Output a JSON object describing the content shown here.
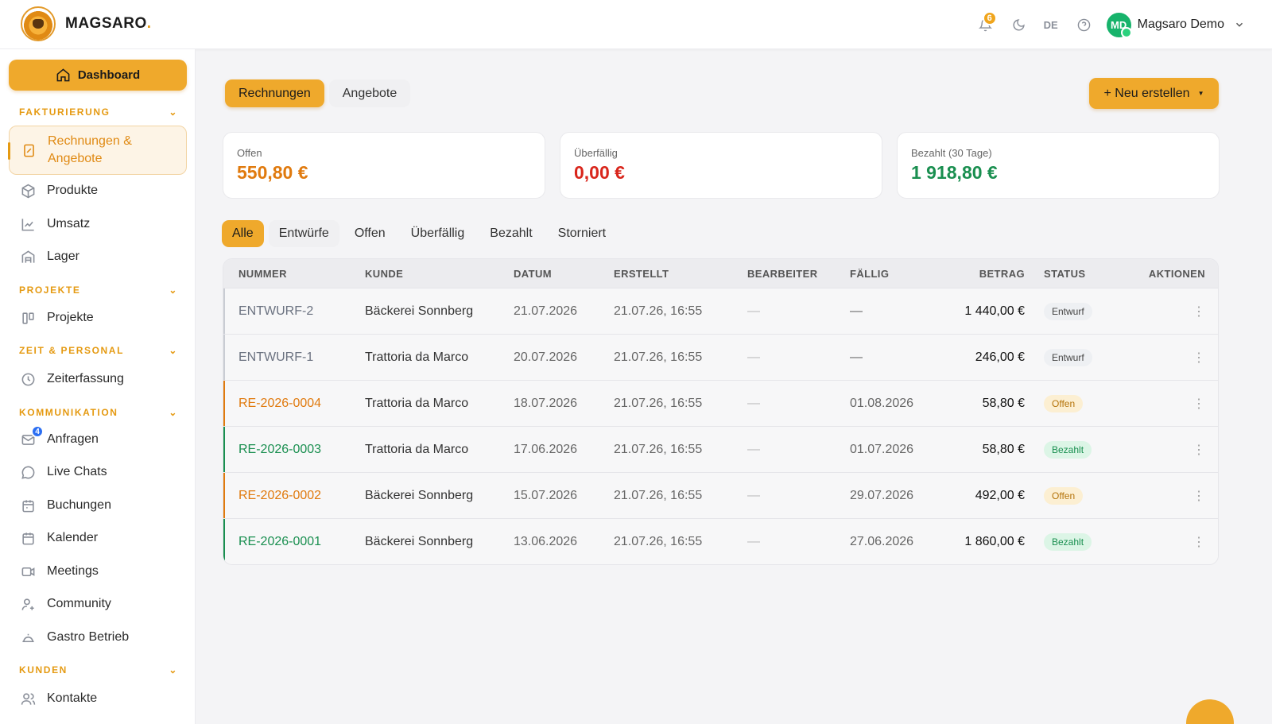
{
  "brand": {
    "name": "MAGSARO",
    "dot": "."
  },
  "header": {
    "notifications_count": "6",
    "language": "DE",
    "user_initials": "MD",
    "user_name": "Magsaro Demo"
  },
  "sidebar": {
    "dashboard": "Dashboard",
    "sections": [
      {
        "title": "FAKTURIERUNG"
      },
      {
        "title": "PROJEKTE"
      },
      {
        "title": "ZEIT & PERSONAL"
      },
      {
        "title": "KOMMUNIKATION"
      },
      {
        "title": "KUNDEN"
      }
    ],
    "items": {
      "rechnungen_line1": "Rechnungen &",
      "rechnungen_line2": "Angebote",
      "produkte": "Produkte",
      "umsatz": "Umsatz",
      "lager": "Lager",
      "projekte": "Projekte",
      "zeiterfassung": "Zeiterfassung",
      "anfragen": "Anfragen",
      "anfragen_badge": "4",
      "live_chats": "Live Chats",
      "buchungen": "Buchungen",
      "kalender": "Kalender",
      "meetings": "Meetings",
      "community": "Community",
      "gastro": "Gastro Betrieb",
      "kontakte": "Kontakte"
    }
  },
  "main": {
    "tabs": [
      "Rechnungen",
      "Angebote"
    ],
    "new_button": "+ Neu erstellen",
    "cards": [
      {
        "label": "Offen",
        "value": "550,80 €",
        "color": "#e07a0e"
      },
      {
        "label": "Überfällig",
        "value": "0,00 €",
        "color": "#d9261c"
      },
      {
        "label": "Bezahlt (30 Tage)",
        "value": "1 918,80 €",
        "color": "#1a8f50"
      }
    ],
    "filters": [
      "Alle",
      "Entwürfe",
      "Offen",
      "Überfällig",
      "Bezahlt",
      "Storniert"
    ],
    "columns": [
      "NUMMER",
      "KUNDE",
      "DATUM",
      "ERSTELLT",
      "BEARBEITER",
      "FÄLLIG",
      "BETRAG",
      "STATUS",
      "AKTIONEN"
    ],
    "rows": [
      {
        "nummer": "ENTWURF-2",
        "kunde": "Bäckerei Sonnberg",
        "datum": "21.07.2026",
        "erstellt": "21.07.26, 16:55",
        "bearbeiter": "—",
        "faellig": "—",
        "betrag": "1 440,00 €",
        "status": "Entwurf",
        "action": "⋮"
      },
      {
        "nummer": "ENTWURF-1",
        "kunde": "Trattoria da Marco",
        "datum": "20.07.2026",
        "erstellt": "21.07.26, 16:55",
        "bearbeiter": "—",
        "faellig": "—",
        "betrag": "246,00 €",
        "status": "Entwurf",
        "action": "⋮"
      },
      {
        "nummer": "RE-2026-0004",
        "kunde": "Trattoria da Marco",
        "datum": "18.07.2026",
        "erstellt": "21.07.26, 16:55",
        "bearbeiter": "—",
        "faellig": "01.08.2026",
        "betrag": "58,80 €",
        "status": "Offen",
        "action": "⋮"
      },
      {
        "nummer": "RE-2026-0003",
        "kunde": "Trattoria da Marco",
        "datum": "17.06.2026",
        "erstellt": "21.07.26, 16:55",
        "bearbeiter": "—",
        "faellig": "01.07.2026",
        "betrag": "58,80 €",
        "status": "Bezahlt",
        "action": "⋮"
      },
      {
        "nummer": "RE-2026-0002",
        "kunde": "Bäckerei Sonnberg",
        "datum": "15.07.2026",
        "erstellt": "21.07.26, 16:55",
        "bearbeiter": "—",
        "faellig": "29.07.2026",
        "betrag": "492,00 €",
        "status": "Offen",
        "action": "⋮"
      },
      {
        "nummer": "RE-2026-0001",
        "kunde": "Bäckerei Sonnberg",
        "datum": "13.06.2026",
        "erstellt": "21.07.26, 16:55",
        "bearbeiter": "—",
        "faellig": "27.06.2026",
        "betrag": "1 860,00 €",
        "status": "Bezahlt",
        "action": "⋮"
      }
    ]
  },
  "colors": {
    "accent": "#efa92c",
    "entwurf": "#6b7280",
    "offen": "#e07a0e",
    "bezahlt": "#1a8f50"
  }
}
